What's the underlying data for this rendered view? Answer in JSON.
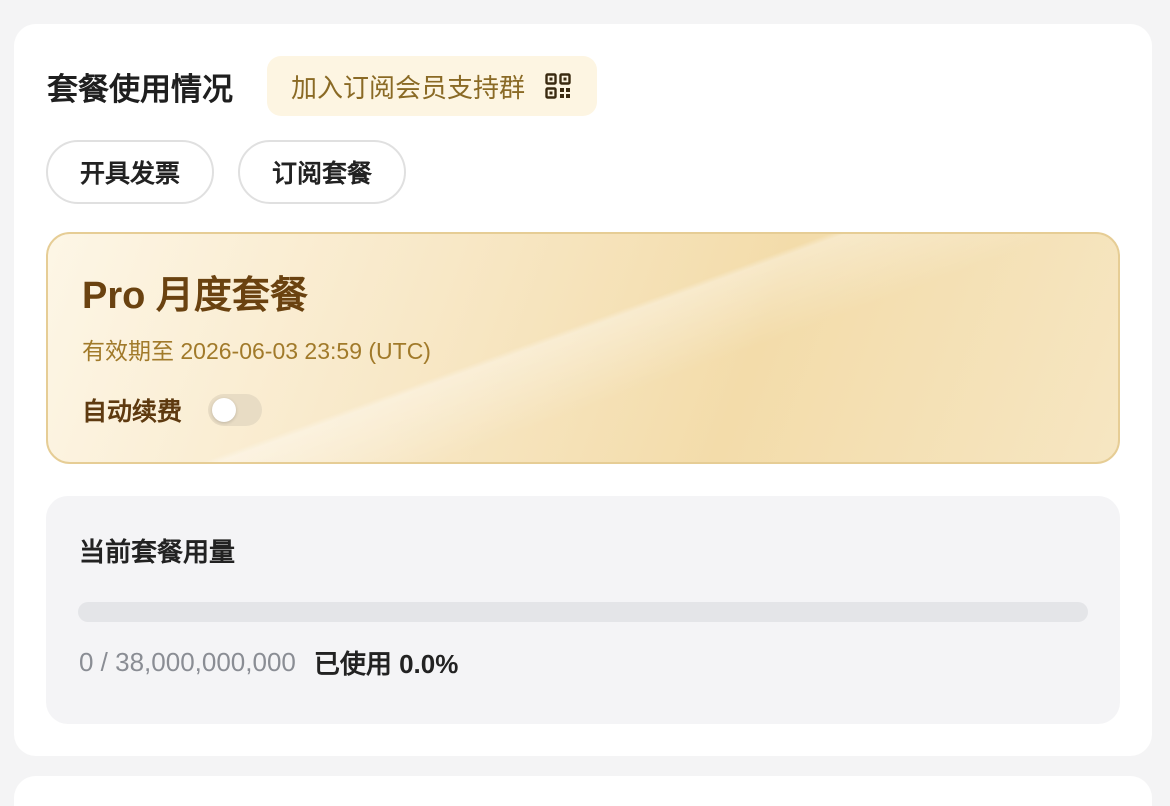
{
  "subscription": {
    "title": "套餐使用情况",
    "support_group_label": "加入订阅会员支持群",
    "support_group_icon": "qr-code-icon",
    "actions": [
      {
        "label": "开具发票"
      },
      {
        "label": "订阅套餐"
      }
    ]
  },
  "plan": {
    "name": "Pro 月度套餐",
    "expiry": "有效期至 2026-06-03 23:59 (UTC)",
    "auto_renew_label": "自动续费",
    "auto_renew_enabled": false
  },
  "usage": {
    "title": "当前套餐用量",
    "used": 0,
    "total": 38000000000,
    "count_text": "0 / 38,000,000,000",
    "used_text": "已使用 0.0%",
    "progress_fraction": 0.0
  },
  "colors": {
    "accent_gold": "#d4a64a",
    "plan_title": "#6a4210",
    "support_group_bg": "#fdf5e2"
  }
}
